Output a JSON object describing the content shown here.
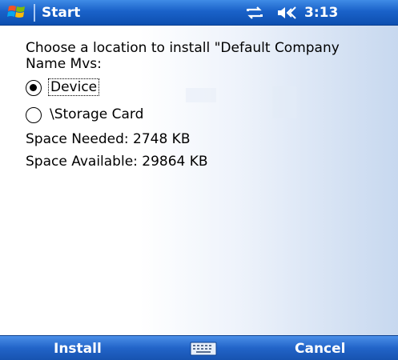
{
  "titlebar": {
    "title": "Start",
    "time": "3:13",
    "start_icon": "windows-flag-icon",
    "connectivity_icon": "connectivity-icon",
    "volume_icon": "speaker-icon"
  },
  "dialog": {
    "prompt": "Choose a location to install \"Default Company Name Mvs:",
    "options": [
      {
        "label": "Device",
        "selected": true
      },
      {
        "label": "\\Storage Card",
        "selected": false
      }
    ],
    "space_needed": "Space Needed:  2748 KB",
    "space_available": "Space Available: 29864 KB"
  },
  "menubar": {
    "left_softkey": "Install",
    "right_softkey": "Cancel",
    "keyboard_icon": "keyboard-icon"
  },
  "colors": {
    "titlebar": "#1a62c9",
    "menubar": "#2264c8",
    "text": "#000000"
  }
}
